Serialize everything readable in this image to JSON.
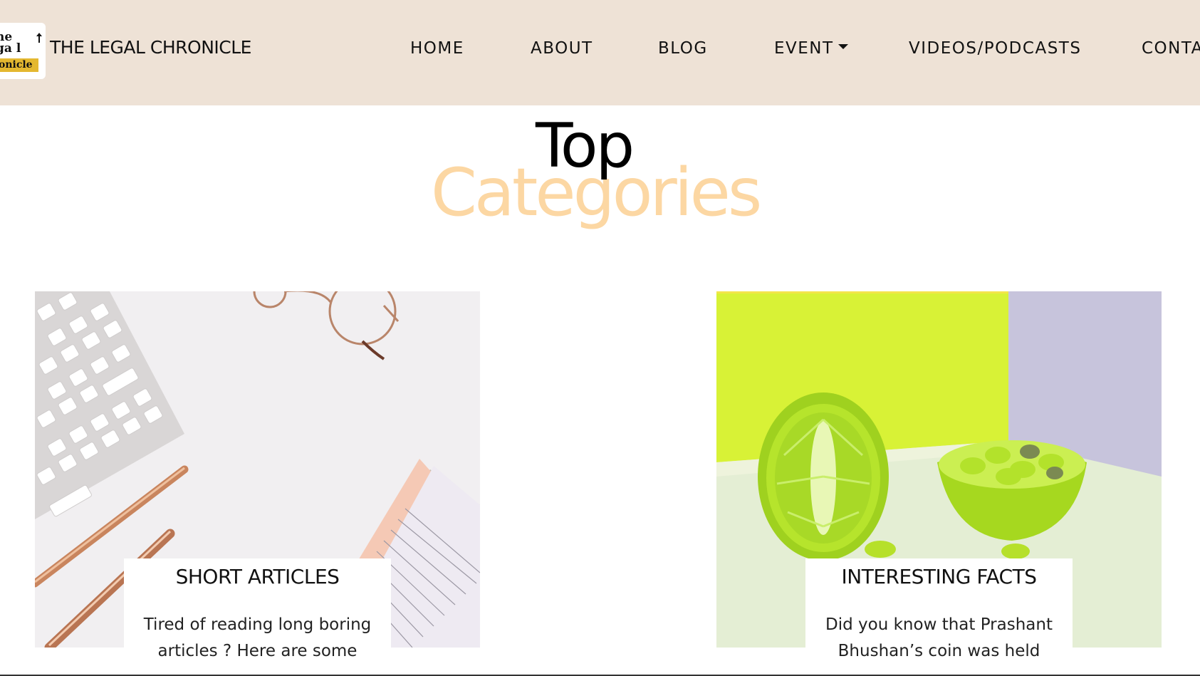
{
  "header": {
    "logo": {
      "line1": "he",
      "line2": "ga l",
      "line3": "onicle",
      "accent_color": "#e4b830"
    },
    "brand": "THE LEGAL CHRONICLE",
    "background": "#eee2d6"
  },
  "nav": {
    "items": [
      {
        "label": "HOME"
      },
      {
        "label": "ABOUT"
      },
      {
        "label": "BLOG"
      },
      {
        "label": "EVENT",
        "has_dropdown": true,
        "dropdown_icon": "caret-down-icon"
      },
      {
        "label": "VIDEOS/PODCASTS"
      },
      {
        "label": "CONTA"
      }
    ]
  },
  "section": {
    "title_top": "Top",
    "title_bottom": "Categories",
    "title_bottom_color": "#fcd7a3"
  },
  "cards": [
    {
      "title": "SHORT ARTICLES",
      "description": "Tired of reading long boring articles ? Here are some",
      "image": "desk-flatlay-keyboard-glasses-pens-image"
    },
    {
      "title": "INTERESTING FACTS",
      "description": "Did you know that Prashant Bhushan’s coin was held",
      "image": "lime-fruit-with-candies-image"
    }
  ]
}
